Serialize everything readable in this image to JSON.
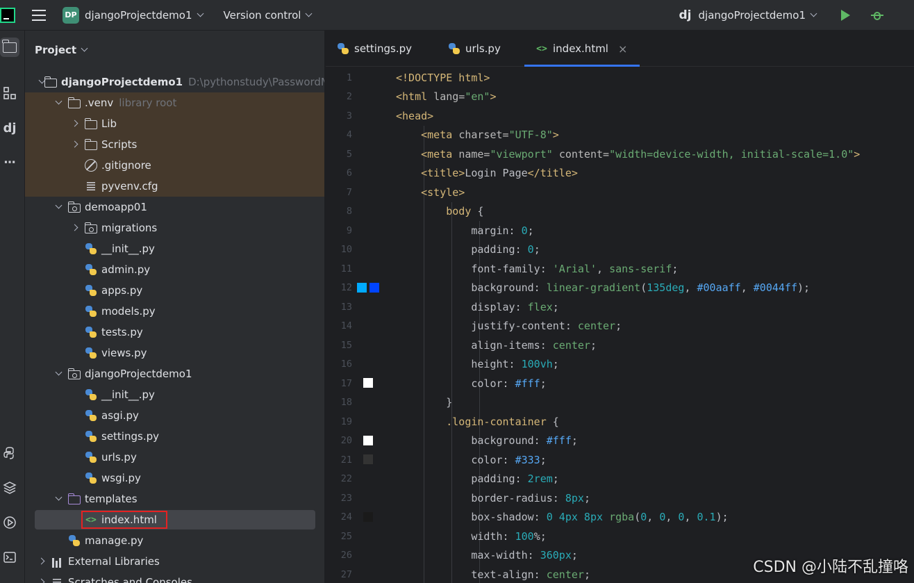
{
  "titlebar": {
    "project_badge": "DP",
    "project_name": "djangoProjectdemo1",
    "version_control": "Version control",
    "run_config_icon": "dj",
    "run_config": "djangoProjectdemo1"
  },
  "project_panel": {
    "title": "Project",
    "rows": [
      {
        "label": "djangoProjectdemo1",
        "hint": "D:\\pythonstudy\\PasswordM",
        "icon": "folder",
        "arrow": "down",
        "indent": 0
      },
      {
        "label": ".venv",
        "hint": "library root",
        "icon": "folder",
        "arrow": "down",
        "indent": 1
      },
      {
        "label": "Lib",
        "hint": "",
        "icon": "folder",
        "arrow": "right",
        "indent": 2
      },
      {
        "label": "Scripts",
        "hint": "",
        "icon": "folder",
        "arrow": "right",
        "indent": 2
      },
      {
        "label": ".gitignore",
        "hint": "",
        "icon": "ignore",
        "arrow": "none",
        "indent": 2
      },
      {
        "label": "pyvenv.cfg",
        "hint": "",
        "icon": "cfg",
        "arrow": "none",
        "indent": 2
      },
      {
        "label": "demoapp01",
        "hint": "",
        "icon": "folder-dot",
        "arrow": "down",
        "indent": 1
      },
      {
        "label": "migrations",
        "hint": "",
        "icon": "folder-dot",
        "arrow": "right",
        "indent": 2
      },
      {
        "label": "__init__.py",
        "hint": "",
        "icon": "python",
        "arrow": "none",
        "indent": 2
      },
      {
        "label": "admin.py",
        "hint": "",
        "icon": "python",
        "arrow": "none",
        "indent": 2
      },
      {
        "label": "apps.py",
        "hint": "",
        "icon": "python",
        "arrow": "none",
        "indent": 2
      },
      {
        "label": "models.py",
        "hint": "",
        "icon": "python",
        "arrow": "none",
        "indent": 2
      },
      {
        "label": "tests.py",
        "hint": "",
        "icon": "python",
        "arrow": "none",
        "indent": 2
      },
      {
        "label": "views.py",
        "hint": "",
        "icon": "python",
        "arrow": "none",
        "indent": 2
      },
      {
        "label": "djangoProjectdemo1",
        "hint": "",
        "icon": "folder-dot",
        "arrow": "down",
        "indent": 1
      },
      {
        "label": "__init__.py",
        "hint": "",
        "icon": "python",
        "arrow": "none",
        "indent": 2
      },
      {
        "label": "asgi.py",
        "hint": "",
        "icon": "python",
        "arrow": "none",
        "indent": 2
      },
      {
        "label": "settings.py",
        "hint": "",
        "icon": "python",
        "arrow": "none",
        "indent": 2
      },
      {
        "label": "urls.py",
        "hint": "",
        "icon": "python",
        "arrow": "none",
        "indent": 2
      },
      {
        "label": "wsgi.py",
        "hint": "",
        "icon": "python",
        "arrow": "none",
        "indent": 2
      },
      {
        "label": "templates",
        "hint": "",
        "icon": "folder-purple",
        "arrow": "down",
        "indent": 1
      },
      {
        "label": "index.html",
        "hint": "",
        "icon": "html",
        "arrow": "none",
        "indent": 2
      },
      {
        "label": "manage.py",
        "hint": "",
        "icon": "python",
        "arrow": "none",
        "indent": 1
      },
      {
        "label": "External Libraries",
        "hint": "",
        "icon": "library",
        "arrow": "right",
        "indent": 0
      },
      {
        "label": "Scratches and Consoles",
        "hint": "",
        "icon": "scratch",
        "arrow": "right",
        "indent": 0
      }
    ]
  },
  "tabs": [
    {
      "label": "settings.py",
      "icon": "python"
    },
    {
      "label": "urls.py",
      "icon": "python"
    },
    {
      "label": "index.html",
      "icon": "html",
      "active": true
    }
  ],
  "code_lines": [
    [
      [
        "tg",
        "<!DOCTYPE html>"
      ]
    ],
    [
      [
        "tg",
        "<html "
      ],
      [
        "at",
        "lang="
      ],
      [
        "st",
        "\"en\""
      ],
      [
        "tg",
        ">"
      ]
    ],
    [
      [
        "tg",
        "<head>"
      ]
    ],
    [
      [
        "tx",
        "    "
      ],
      [
        "tg",
        "<meta "
      ],
      [
        "at",
        "charset="
      ],
      [
        "st",
        "\"UTF-8\""
      ],
      [
        "tg",
        ">"
      ]
    ],
    [
      [
        "tx",
        "    "
      ],
      [
        "tg",
        "<meta "
      ],
      [
        "at",
        "name="
      ],
      [
        "st",
        "\"viewport\" "
      ],
      [
        "at",
        "content="
      ],
      [
        "st",
        "\"width=device-width, initial-scale=1.0\""
      ],
      [
        "tg",
        ">"
      ]
    ],
    [
      [
        "tx",
        "    "
      ],
      [
        "tg",
        "<title>"
      ],
      [
        "tx",
        "Login Page"
      ],
      [
        "tg",
        "</title>"
      ]
    ],
    [
      [
        "tx",
        "    "
      ],
      [
        "tg",
        "<style>"
      ]
    ],
    [
      [
        "tx",
        "        "
      ],
      [
        "sel",
        "body "
      ],
      [
        "tx",
        "{"
      ]
    ],
    [
      [
        "tx",
        "            "
      ],
      [
        "pr",
        "margin: "
      ],
      [
        "nm",
        "0"
      ],
      [
        "tx",
        ";"
      ]
    ],
    [
      [
        "tx",
        "            "
      ],
      [
        "pr",
        "padding: "
      ],
      [
        "nm",
        "0"
      ],
      [
        "tx",
        ";"
      ]
    ],
    [
      [
        "tx",
        "            "
      ],
      [
        "pr",
        "font-family: "
      ],
      [
        "kw",
        "'Arial'"
      ],
      [
        "tx",
        ", "
      ],
      [
        "kw",
        "sans-serif"
      ],
      [
        "tx",
        ";"
      ]
    ],
    [
      [
        "tx",
        "            "
      ],
      [
        "pr",
        "background: "
      ],
      [
        "kw",
        "linear-gradient"
      ],
      [
        "tx",
        "("
      ],
      [
        "nm",
        "135deg"
      ],
      [
        "tx",
        ", "
      ],
      [
        "hx",
        "#00aaff"
      ],
      [
        "tx",
        ", "
      ],
      [
        "hx",
        "#0044ff"
      ],
      [
        "tx",
        ");"
      ]
    ],
    [
      [
        "tx",
        "            "
      ],
      [
        "pr",
        "display: "
      ],
      [
        "kw",
        "flex"
      ],
      [
        "tx",
        ";"
      ]
    ],
    [
      [
        "tx",
        "            "
      ],
      [
        "pr",
        "justify-content: "
      ],
      [
        "kw",
        "center"
      ],
      [
        "tx",
        ";"
      ]
    ],
    [
      [
        "tx",
        "            "
      ],
      [
        "pr",
        "align-items: "
      ],
      [
        "kw",
        "center"
      ],
      [
        "tx",
        ";"
      ]
    ],
    [
      [
        "tx",
        "            "
      ],
      [
        "pr",
        "height: "
      ],
      [
        "nm",
        "100vh"
      ],
      [
        "tx",
        ";"
      ]
    ],
    [
      [
        "tx",
        "            "
      ],
      [
        "pr",
        "color: "
      ],
      [
        "hx",
        "#fff"
      ],
      [
        "tx",
        ";"
      ]
    ],
    [
      [
        "tx",
        "        }"
      ]
    ],
    [
      [
        "tx",
        "        "
      ],
      [
        "sel",
        ".login-container "
      ],
      [
        "tx",
        "{"
      ]
    ],
    [
      [
        "tx",
        "            "
      ],
      [
        "pr",
        "background: "
      ],
      [
        "hx",
        "#fff"
      ],
      [
        "tx",
        ";"
      ]
    ],
    [
      [
        "tx",
        "            "
      ],
      [
        "pr",
        "color: "
      ],
      [
        "hx",
        "#333"
      ],
      [
        "tx",
        ";"
      ]
    ],
    [
      [
        "tx",
        "            "
      ],
      [
        "pr",
        "padding: "
      ],
      [
        "nm",
        "2rem"
      ],
      [
        "tx",
        ";"
      ]
    ],
    [
      [
        "tx",
        "            "
      ],
      [
        "pr",
        "border-radius: "
      ],
      [
        "nm",
        "8px"
      ],
      [
        "tx",
        ";"
      ]
    ],
    [
      [
        "tx",
        "            "
      ],
      [
        "pr",
        "box-shadow: "
      ],
      [
        "nm",
        "0 4px 8px "
      ],
      [
        "kw",
        "rgba"
      ],
      [
        "tx",
        "("
      ],
      [
        "nm",
        "0"
      ],
      [
        "tx",
        ", "
      ],
      [
        "nm",
        "0"
      ],
      [
        "tx",
        ", "
      ],
      [
        "nm",
        "0"
      ],
      [
        "tx",
        ", "
      ],
      [
        "nm",
        "0.1"
      ],
      [
        "tx",
        ");"
      ]
    ],
    [
      [
        "tx",
        "            "
      ],
      [
        "pr",
        "width: "
      ],
      [
        "nm",
        "100"
      ],
      [
        "tx",
        "%;"
      ]
    ],
    [
      [
        "tx",
        "            "
      ],
      [
        "pr",
        "max-width: "
      ],
      [
        "nm",
        "360px"
      ],
      [
        "tx",
        ";"
      ]
    ],
    [
      [
        "tx",
        "            "
      ],
      [
        "pr",
        "text-align: "
      ],
      [
        "kw",
        "center"
      ],
      [
        "tx",
        ";"
      ]
    ]
  ],
  "swatches": {
    "12": [
      "#00aaff",
      "#0044ff"
    ],
    "17": [
      "#ffffff"
    ],
    "20": [
      "#ffffff"
    ],
    "21": [
      "#333333"
    ],
    "24": [
      "#1a1a1a"
    ]
  },
  "watermark": "CSDN @小陆不乱撞咯"
}
